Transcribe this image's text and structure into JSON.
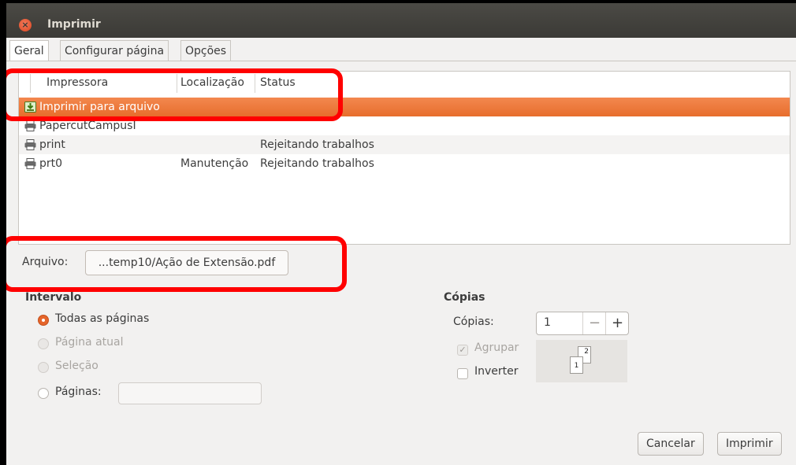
{
  "window": {
    "title": "Imprimir"
  },
  "tabs": [
    {
      "label": "Geral",
      "active": true
    },
    {
      "label": "Configurar página",
      "active": false
    },
    {
      "label": "Opções",
      "active": false
    }
  ],
  "printer_list": {
    "columns": [
      "Impressora",
      "Localização",
      "Status"
    ],
    "rows": [
      {
        "name": "Imprimir para arquivo",
        "location": "",
        "status": "",
        "icon": "save-to-file-icon",
        "selected": true
      },
      {
        "name": "PapercutCampusI",
        "location": "",
        "status": "",
        "icon": "printer-icon",
        "selected": false
      },
      {
        "name": "print",
        "location": "",
        "status": "Rejeitando trabalhos",
        "icon": "printer-icon",
        "selected": false
      },
      {
        "name": "prt0",
        "location": "Manutenção",
        "status": "Rejeitando trabalhos",
        "icon": "printer-icon",
        "selected": false
      }
    ]
  },
  "file": {
    "label": "Arquivo:",
    "value": "...temp10/Ação de Extensão.pdf"
  },
  "range": {
    "title": "Intervalo",
    "options": [
      {
        "label": "Todas as páginas",
        "selected": true,
        "enabled": true
      },
      {
        "label": "Página atual",
        "selected": false,
        "enabled": false
      },
      {
        "label": "Seleção",
        "selected": false,
        "enabled": false
      },
      {
        "label": "Páginas:",
        "selected": false,
        "enabled": true
      }
    ],
    "pages_value": ""
  },
  "copies": {
    "title": "Cópias",
    "label": "Cópias:",
    "value": "1",
    "minus": "−",
    "plus": "+",
    "collate_label": "Agrupar",
    "collate_checked": true,
    "collate_enabled": false,
    "reverse_label": "Inverter",
    "reverse_checked": false,
    "preview_pages": [
      "1",
      "2"
    ]
  },
  "buttons": {
    "cancel": "Cancelar",
    "print": "Imprimir"
  },
  "colors": {
    "selection": "#e76d2c",
    "highlight": "#ff0000",
    "titlebar": "#3b3a36"
  }
}
